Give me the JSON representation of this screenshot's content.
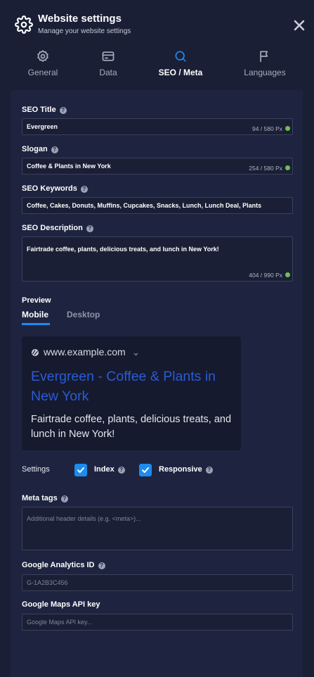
{
  "header": {
    "title": "Website settings",
    "subtitle": "Manage your website settings",
    "icon": "gear-icon",
    "close_icon": "close-icon"
  },
  "tabs": [
    {
      "label": "General",
      "icon": "gear-icon"
    },
    {
      "label": "Data",
      "icon": "card-icon"
    },
    {
      "label": "SEO / Meta",
      "icon": "search-icon",
      "active": true
    },
    {
      "label": "Languages",
      "icon": "flag-icon"
    }
  ],
  "seo": {
    "title_label": "SEO Title",
    "title_value": "Evergreen",
    "title_counter": "94 / 580 Px",
    "slogan_label": "Slogan",
    "slogan_value": "Coffee & Plants in New York",
    "slogan_counter": "254 / 580 Px",
    "keywords_label": "SEO Keywords",
    "keywords_value": "Coffee, Cakes, Donuts, Muffins, Cupcakes, Snacks, Lunch, Lunch Deal, Plants",
    "description_label": "SEO Description",
    "description_value": "Fairtrade coffee, plants, delicious treats, and lunch in New York!",
    "description_counter": "404 / 990 Px"
  },
  "preview": {
    "label": "Preview",
    "tab_mobile": "Mobile",
    "tab_desktop": "Desktop",
    "url": "www.example.com",
    "title": "Evergreen - Coffee & Plants in New York",
    "description": "Fairtrade coffee, plants, delicious treats, and lunch in New York!"
  },
  "settings": {
    "label": "Settings",
    "index_label": "Index",
    "index_checked": true,
    "responsive_label": "Responsive",
    "responsive_checked": true
  },
  "meta_tags": {
    "label": "Meta tags",
    "placeholder": "Additional header details (e.g. <meta>)..."
  },
  "analytics": {
    "label": "Google Analytics ID",
    "placeholder": "G-1A2B3C456"
  },
  "maps": {
    "label": "Google Maps API key",
    "placeholder": "Google Maps API key..."
  },
  "colors": {
    "background": "#1a1f36",
    "panel": "#1e2440",
    "accent": "#1d8cf0",
    "link": "#2a5bd7",
    "ok_dot": "#6fbf54"
  }
}
